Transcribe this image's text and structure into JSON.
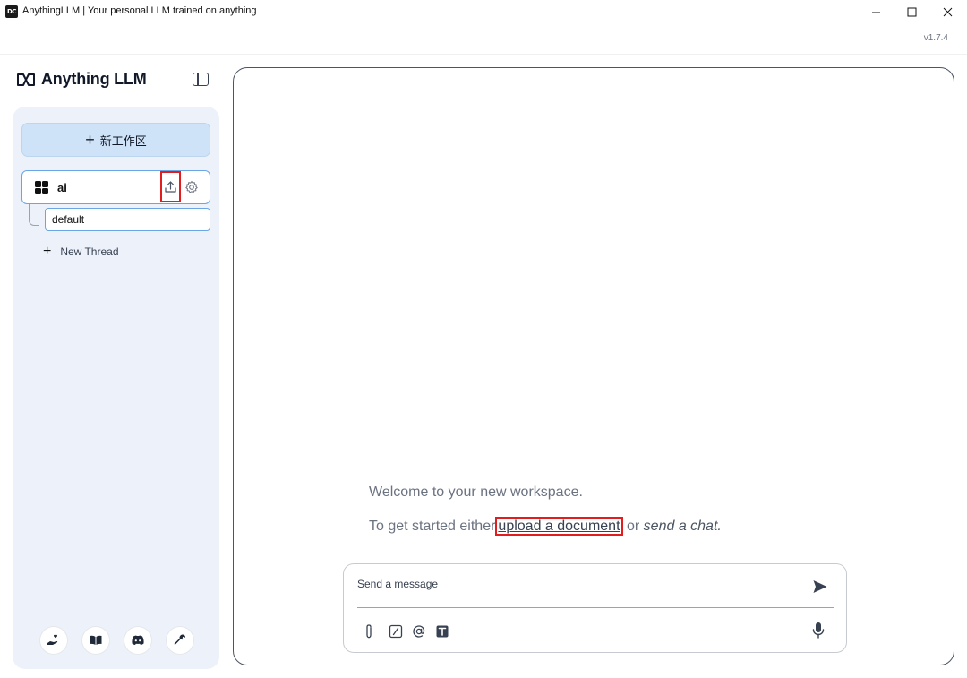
{
  "window": {
    "title": "AnythingLLM | Your personal LLM trained on anything",
    "app_icon_text": "DC",
    "version": "v1.7.4"
  },
  "sidebar": {
    "brand": "Anything LLM",
    "new_workspace_label": "新工作区",
    "workspaces": [
      {
        "name": "ai",
        "threads": [
          {
            "name": "default"
          }
        ]
      }
    ],
    "new_thread_label": "New Thread"
  },
  "main": {
    "welcome_text": "Welcome to your new workspace.",
    "get_started_prefix": "To get started either",
    "upload_link": "upload a document",
    "or_text": "or",
    "send_chat": "send a chat."
  },
  "composer": {
    "placeholder": "Send a message"
  },
  "colors": {
    "accent_border": "#6aa6e6",
    "new_workspace_bg": "#cfe3f8",
    "sidebar_bg": "#edf2fa",
    "highlight_red": "#e11d1d"
  }
}
